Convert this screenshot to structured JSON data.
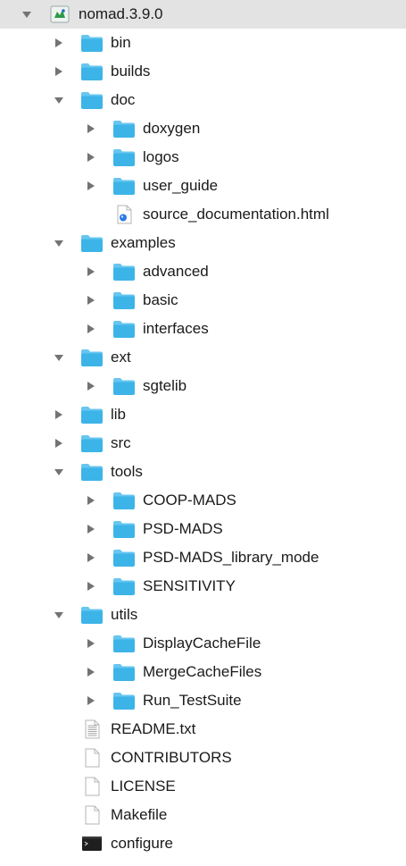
{
  "colors": {
    "folder": "#3cb4e8",
    "folder_tab": "#67c6f0",
    "disclosure": "#737373",
    "selected_row": "#e3e3e3"
  },
  "tree": [
    {
      "label": "nomad.3.9.0",
      "depth": 0,
      "expanded": true,
      "icon": "app-icon",
      "selected": true
    },
    {
      "label": "bin",
      "depth": 1,
      "expanded": false,
      "icon": "folder-icon"
    },
    {
      "label": "builds",
      "depth": 1,
      "expanded": false,
      "icon": "folder-icon"
    },
    {
      "label": "doc",
      "depth": 1,
      "expanded": true,
      "icon": "folder-icon"
    },
    {
      "label": "doxygen",
      "depth": 2,
      "expanded": false,
      "icon": "folder-icon"
    },
    {
      "label": "logos",
      "depth": 2,
      "expanded": false,
      "icon": "folder-icon"
    },
    {
      "label": "user_guide",
      "depth": 2,
      "expanded": false,
      "icon": "folder-icon"
    },
    {
      "label": "source_documentation.html",
      "depth": 2,
      "icon": "html-file-icon"
    },
    {
      "label": "examples",
      "depth": 1,
      "expanded": true,
      "icon": "folder-icon"
    },
    {
      "label": "advanced",
      "depth": 2,
      "expanded": false,
      "icon": "folder-icon"
    },
    {
      "label": "basic",
      "depth": 2,
      "expanded": false,
      "icon": "folder-icon"
    },
    {
      "label": "interfaces",
      "depth": 2,
      "expanded": false,
      "icon": "folder-icon"
    },
    {
      "label": "ext",
      "depth": 1,
      "expanded": true,
      "icon": "folder-icon"
    },
    {
      "label": "sgtelib",
      "depth": 2,
      "expanded": false,
      "icon": "folder-icon"
    },
    {
      "label": "lib",
      "depth": 1,
      "expanded": false,
      "icon": "folder-icon"
    },
    {
      "label": "src",
      "depth": 1,
      "expanded": false,
      "icon": "folder-icon"
    },
    {
      "label": "tools",
      "depth": 1,
      "expanded": true,
      "icon": "folder-icon"
    },
    {
      "label": "COOP-MADS",
      "depth": 2,
      "expanded": false,
      "icon": "folder-icon"
    },
    {
      "label": "PSD-MADS",
      "depth": 2,
      "expanded": false,
      "icon": "folder-icon"
    },
    {
      "label": "PSD-MADS_library_mode",
      "depth": 2,
      "expanded": false,
      "icon": "folder-icon"
    },
    {
      "label": "SENSITIVITY",
      "depth": 2,
      "expanded": false,
      "icon": "folder-icon"
    },
    {
      "label": "utils",
      "depth": 1,
      "expanded": true,
      "icon": "folder-icon"
    },
    {
      "label": "DisplayCacheFile",
      "depth": 2,
      "expanded": false,
      "icon": "folder-icon"
    },
    {
      "label": "MergeCacheFiles",
      "depth": 2,
      "expanded": false,
      "icon": "folder-icon"
    },
    {
      "label": "Run_TestSuite",
      "depth": 2,
      "expanded": false,
      "icon": "folder-icon"
    },
    {
      "label": "README.txt",
      "depth": 1,
      "icon": "text-file-icon"
    },
    {
      "label": "CONTRIBUTORS",
      "depth": 1,
      "icon": "blank-file-icon"
    },
    {
      "label": "LICENSE",
      "depth": 1,
      "icon": "blank-file-icon"
    },
    {
      "label": "Makefile",
      "depth": 1,
      "icon": "blank-file-icon"
    },
    {
      "label": "configure",
      "depth": 1,
      "icon": "terminal-icon"
    }
  ]
}
